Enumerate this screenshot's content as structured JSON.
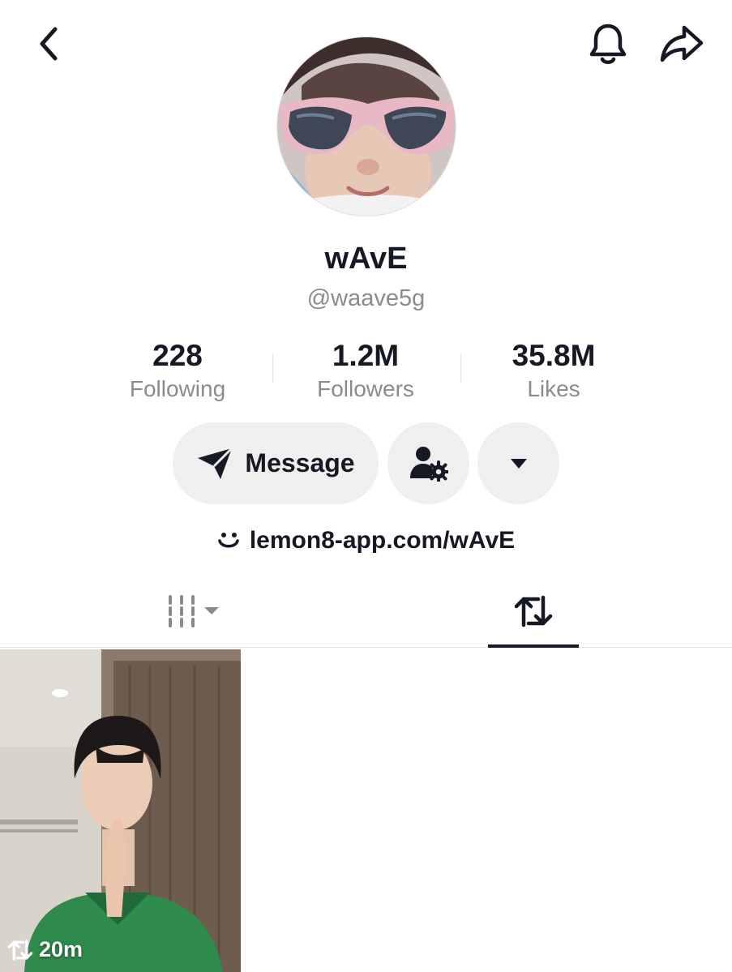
{
  "profile": {
    "display_name": "wAvE",
    "username": "@waave5g"
  },
  "stats": {
    "following": {
      "value": "228",
      "label": "Following"
    },
    "followers": {
      "value": "1.2M",
      "label": "Followers"
    },
    "likes": {
      "value": "35.8M",
      "label": "Likes"
    }
  },
  "actions": {
    "message_label": "Message"
  },
  "bio": {
    "link": "lemon8-app.com/wAvE"
  },
  "tabs": {
    "active": "reposts"
  },
  "videos": [
    {
      "repost_time": "20m"
    }
  ],
  "icons": {
    "back": "chevron-left-icon",
    "bell": "bell-icon",
    "share": "share-arrow-icon",
    "message": "paper-plane-icon",
    "follow_settings": "user-gear-icon",
    "more": "caret-down-icon",
    "link": "lemon8-smile-icon",
    "videos_tab": "grid-filter-icon",
    "reposts_tab": "repost-icon"
  }
}
